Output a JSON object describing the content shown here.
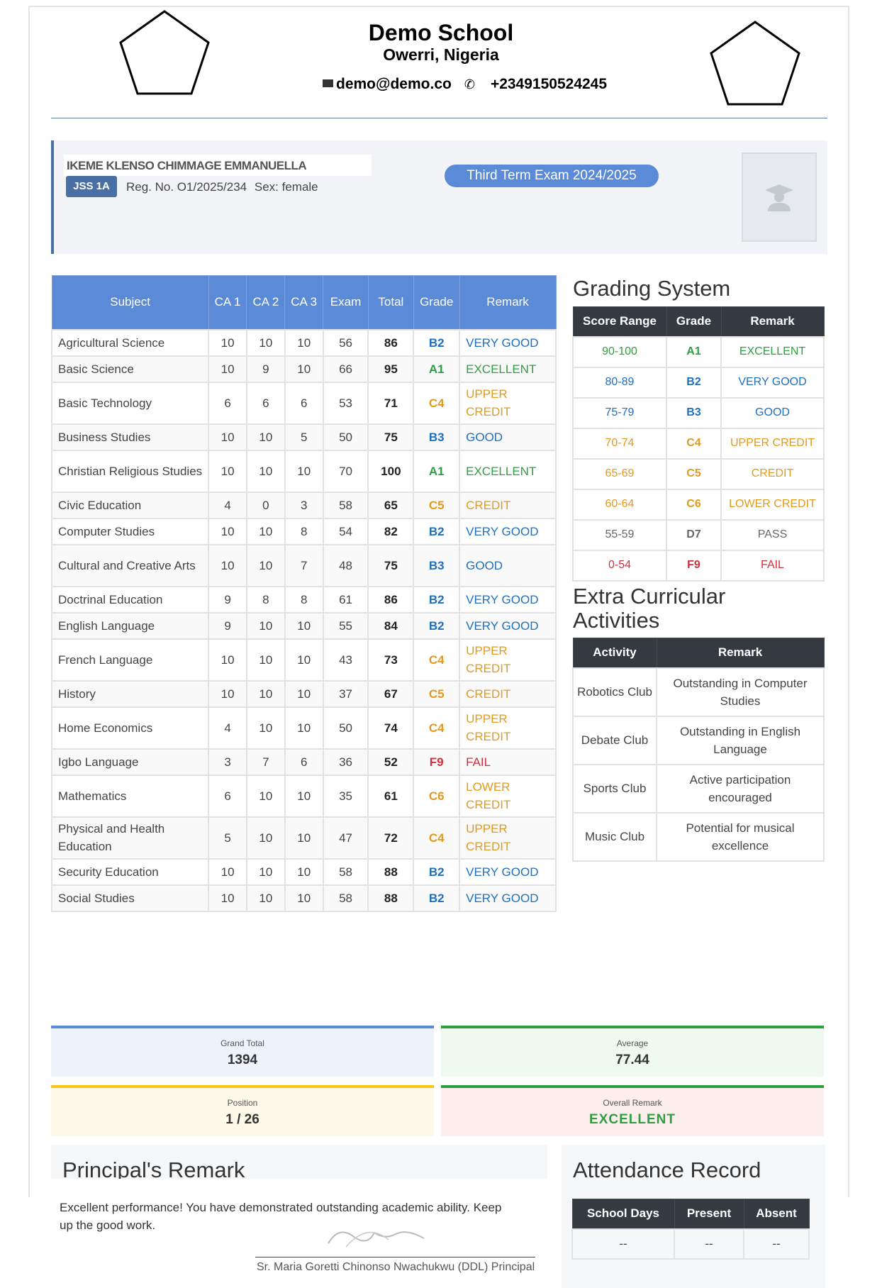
{
  "header": {
    "school_name": "Demo School",
    "location": "Owerri, Nigeria",
    "email": "demo@demo.co",
    "phone": "+2349150524245"
  },
  "student": {
    "name": "IKEME KLENSO CHIMMAGE EMMANUELLA",
    "class": "JSS 1A",
    "reg_no": "Reg. No. O1/2025/234",
    "sex": "Sex: female",
    "term": "Third Term Exam 2024/2025"
  },
  "subjects_header": [
    "Subject",
    "CA 1",
    "CA 2",
    "CA 3",
    "Exam",
    "Total",
    "Grade",
    "Remark"
  ],
  "subjects": [
    {
      "subject": "Agricultural Science",
      "ca1": "10",
      "ca2": "10",
      "ca3": "10",
      "exam": "56",
      "total": "86",
      "grade": "B2",
      "remark": "VERY GOOD"
    },
    {
      "subject": "Basic Science",
      "ca1": "10",
      "ca2": "9",
      "ca3": "10",
      "exam": "66",
      "total": "95",
      "grade": "A1",
      "remark": "EXCELLENT"
    },
    {
      "subject": "Basic Technology",
      "ca1": "6",
      "ca2": "6",
      "ca3": "6",
      "exam": "53",
      "total": "71",
      "grade": "C4",
      "remark": "UPPER CREDIT"
    },
    {
      "subject": "Business Studies",
      "ca1": "10",
      "ca2": "10",
      "ca3": "5",
      "exam": "50",
      "total": "75",
      "grade": "B3",
      "remark": "GOOD"
    },
    {
      "subject": "Christian Religious Studies",
      "ca1": "10",
      "ca2": "10",
      "ca3": "10",
      "exam": "70",
      "total": "100",
      "grade": "A1",
      "remark": "EXCELLENT"
    },
    {
      "subject": "Civic Education",
      "ca1": "4",
      "ca2": "0",
      "ca3": "3",
      "exam": "58",
      "total": "65",
      "grade": "C5",
      "remark": "CREDIT"
    },
    {
      "subject": "Computer Studies",
      "ca1": "10",
      "ca2": "10",
      "ca3": "8",
      "exam": "54",
      "total": "82",
      "grade": "B2",
      "remark": "VERY GOOD"
    },
    {
      "subject": "Cultural and Creative Arts",
      "ca1": "10",
      "ca2": "10",
      "ca3": "7",
      "exam": "48",
      "total": "75",
      "grade": "B3",
      "remark": "GOOD"
    },
    {
      "subject": "Doctrinal Education",
      "ca1": "9",
      "ca2": "8",
      "ca3": "8",
      "exam": "61",
      "total": "86",
      "grade": "B2",
      "remark": "VERY GOOD"
    },
    {
      "subject": "English Language",
      "ca1": "9",
      "ca2": "10",
      "ca3": "10",
      "exam": "55",
      "total": "84",
      "grade": "B2",
      "remark": "VERY GOOD"
    },
    {
      "subject": "French Language",
      "ca1": "10",
      "ca2": "10",
      "ca3": "10",
      "exam": "43",
      "total": "73",
      "grade": "C4",
      "remark": "UPPER CREDIT"
    },
    {
      "subject": "History",
      "ca1": "10",
      "ca2": "10",
      "ca3": "10",
      "exam": "37",
      "total": "67",
      "grade": "C5",
      "remark": "CREDIT"
    },
    {
      "subject": "Home Economics",
      "ca1": "4",
      "ca2": "10",
      "ca3": "10",
      "exam": "50",
      "total": "74",
      "grade": "C4",
      "remark": "UPPER CREDIT"
    },
    {
      "subject": "Igbo Language",
      "ca1": "3",
      "ca2": "7",
      "ca3": "6",
      "exam": "36",
      "total": "52",
      "grade": "F9",
      "remark": "FAIL"
    },
    {
      "subject": "Mathematics",
      "ca1": "6",
      "ca2": "10",
      "ca3": "10",
      "exam": "35",
      "total": "61",
      "grade": "C6",
      "remark": "LOWER CREDIT"
    },
    {
      "subject": "Physical and Health Education",
      "ca1": "5",
      "ca2": "10",
      "ca3": "10",
      "exam": "47",
      "total": "72",
      "grade": "C4",
      "remark": "UPPER CREDIT"
    },
    {
      "subject": "Security Education",
      "ca1": "10",
      "ca2": "10",
      "ca3": "10",
      "exam": "58",
      "total": "88",
      "grade": "B2",
      "remark": "VERY GOOD"
    },
    {
      "subject": "Social Studies",
      "ca1": "10",
      "ca2": "10",
      "ca3": "10",
      "exam": "58",
      "total": "88",
      "grade": "B2",
      "remark": "VERY GOOD"
    }
  ],
  "grade_colors": {
    "A1": "#2e9e3e",
    "B2": "#1f6fc1",
    "B3": "#1f6fc1",
    "C4": "#e39a1c",
    "C5": "#e39a1c",
    "C6": "#e39a1c",
    "D7": "#666666",
    "F9": "#d12f3c"
  },
  "grading_system": {
    "title": "Grading System",
    "headers": [
      "Score Range",
      "Grade",
      "Remark"
    ],
    "rows": [
      {
        "range": "90-100",
        "grade": "A1",
        "remark": "EXCELLENT"
      },
      {
        "range": "80-89",
        "grade": "B2",
        "remark": "VERY GOOD"
      },
      {
        "range": "75-79",
        "grade": "B3",
        "remark": "GOOD"
      },
      {
        "range": "70-74",
        "grade": "C4",
        "remark": "UPPER CREDIT"
      },
      {
        "range": "65-69",
        "grade": "C5",
        "remark": "CREDIT"
      },
      {
        "range": "60-64",
        "grade": "C6",
        "remark": "LOWER CREDIT"
      },
      {
        "range": "55-59",
        "grade": "D7",
        "remark": "PASS"
      },
      {
        "range": "0-54",
        "grade": "F9",
        "remark": "FAIL"
      }
    ]
  },
  "activities": {
    "title": "Extra Curricular Activities",
    "headers": [
      "Activity",
      "Remark"
    ],
    "rows": [
      {
        "activity": "Robotics Club",
        "remark": "Outstanding in Computer Studies"
      },
      {
        "activity": "Debate Club",
        "remark": "Outstanding in English Language"
      },
      {
        "activity": "Sports Club",
        "remark": "Active participation encouraged"
      },
      {
        "activity": "Music Club",
        "remark": "Potential for musical excellence"
      }
    ]
  },
  "summary": {
    "grand_total_label": "Grand Total",
    "grand_total": "1394",
    "average_label": "Average",
    "average": "77.44",
    "position_label": "Position",
    "position": "1 / 26",
    "overall_label": "Overall Remark",
    "overall": "EXCELLENT",
    "colors": {
      "blue": "#5b8ad6",
      "green": "#2e9e3e",
      "yellow": "#f5c518",
      "red_bg": "#fdeeee"
    }
  },
  "principal": {
    "title": "Principal's Remark",
    "text": "Excellent performance! You have demonstrated outstanding academic ability. Keep up the good work.",
    "caption": "Sr. Maria Goretti Chinonso Nwachukwu (DDL) Principal"
  },
  "attendance": {
    "title": "Attendance Record",
    "headers": [
      "School Days",
      "Present",
      "Absent"
    ],
    "values": [
      "--",
      "--",
      "--"
    ]
  }
}
